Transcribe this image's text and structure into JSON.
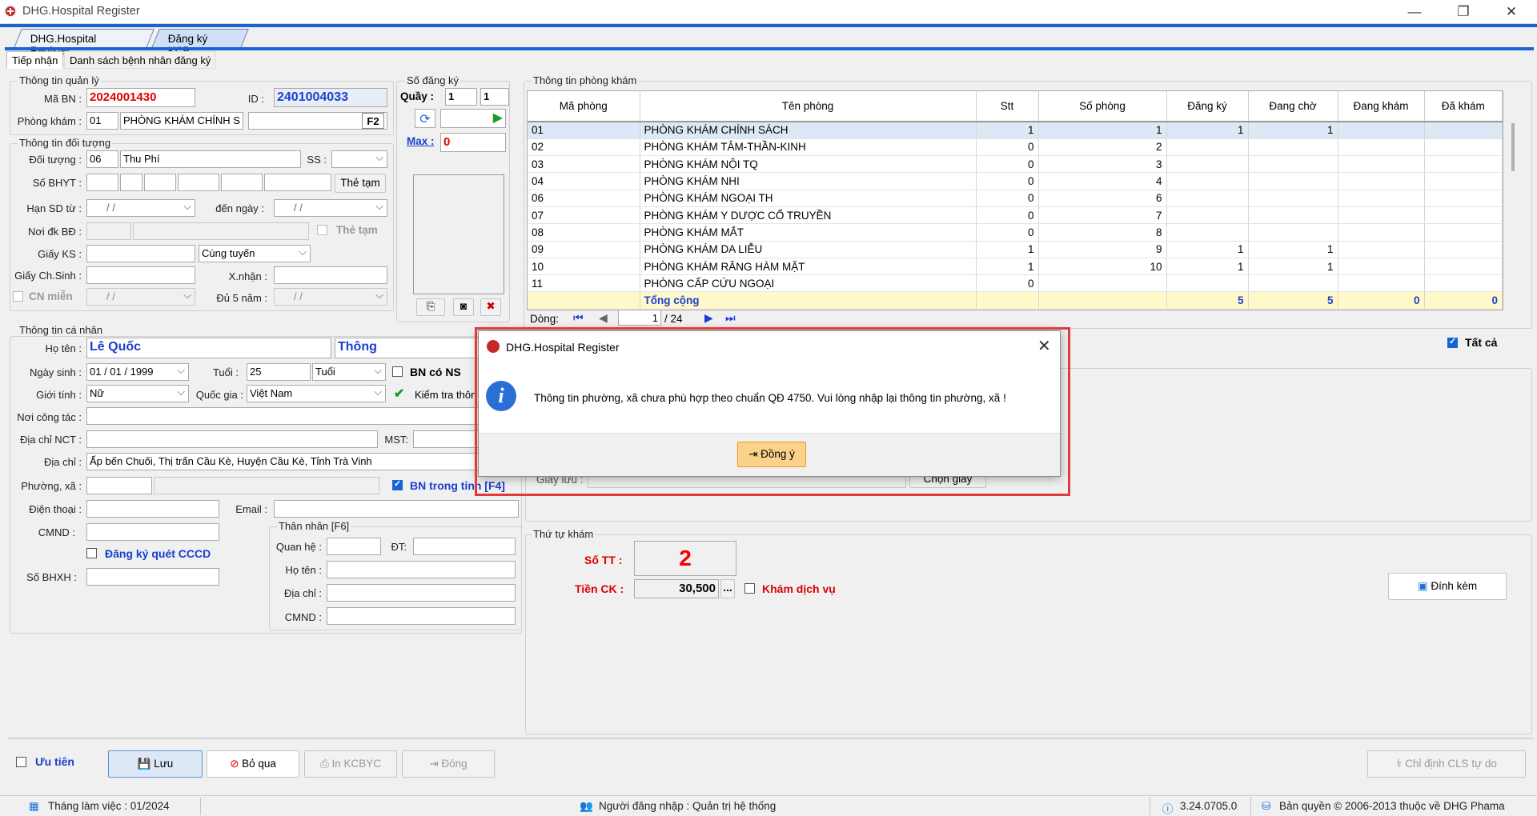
{
  "window": {
    "title": "DHG.Hospital Register",
    "minimize": "—",
    "maximize": "❐",
    "close": "✕"
  },
  "tabs": [
    "DHG.Hospital Register",
    "Đăng ký KCB"
  ],
  "subtabs": [
    "Tiếp nhận",
    "Danh sách bệnh nhân đăng ký"
  ],
  "quanly": {
    "group": "Thông tin quản lý",
    "ma_bn_label": "Mã BN :",
    "ma_bn": "2024001430",
    "id_label": "ID :",
    "id": "2401004033",
    "phong_kham_label": "Phòng khám :",
    "phong_code": "01",
    "phong_name": "PHÒNG KHÁM CHÍNH S",
    "f2": "F2"
  },
  "sodangky": {
    "group": "Số đăng ký",
    "quay_label": "Quầy :",
    "quay1": "1",
    "quay2": "1",
    "max_label": "Max :",
    "max": "0"
  },
  "doituong": {
    "group": "Thông tin đối tượng",
    "doituong_label": "Đối tượng :",
    "code": "06",
    "name": "Thu Phí",
    "ss_label": "SS :",
    "sobhyt_label": "Số BHYT :",
    "the_tam": "Thẻ tạm",
    "hansd_label": "Hạn SD từ :",
    "date_blank": "/ /",
    "den_ngay_label": "đến ngày :",
    "noidk_label": "Nơi đk BĐ :",
    "the_tam2": "Thẻ tạm",
    "giayks_label": "Giấy KS :",
    "cung_tuyen": "Cùng tuyến",
    "giaychsinh_label": "Giấy Ch.Sinh :",
    "xnhan_label": "X.nhận :",
    "cn_mien": "CN miễn",
    "du5nam_label": "Đủ 5 năm :"
  },
  "canhan": {
    "group": "Thông tin cá nhân",
    "hoten_label": "Họ tên :",
    "ho": "Lê Quốc",
    "ten": "Thông",
    "ngaysinh_label": "Ngày sinh :",
    "ngaysinh": "01 / 01 / 1999",
    "tuoi_label": "Tuổi :",
    "tuoi": "25",
    "tuoi_unit": "Tuổi",
    "bn_co_ns": "BN có NS",
    "gioitinh_label": "Giới tính :",
    "gioitinh": "Nữ",
    "quocgia_label": "Quốc gia :",
    "quocgia": "Việt Nam",
    "kiem_tra": "Kiểm tra thôn",
    "noicongtac_label": "Nơi công tác :",
    "diachinct_label": "Địa chỉ NCT :",
    "mst_label": "MST:",
    "diachi_label": "Địa chỉ :",
    "diachi": "Ấp bến Chuối, Thị trấn Cầu Kè, Huyện Cầu Kè, Tỉnh Trà Vinh",
    "phuongxa_label": "Phường, xã :",
    "bn_trong_tinh": "BN trong tỉnh [F4]",
    "dienthoai_label": "Điện thoại :",
    "email_label": "Email :",
    "cmnd_label": "CMND :",
    "dk_quet_cccd": "Đăng ký quét CCCD",
    "sobhxh_label": "Số BHXH :"
  },
  "thannhan": {
    "group": "Thân nhân [F6]",
    "quanhe_label": "Quan hệ :",
    "dt_label": "ĐT:",
    "hoten_label": "Họ tên :",
    "diachi_label": "Địa chỉ :",
    "cmnd_label": "CMND :"
  },
  "phongkham": {
    "group": "Thông tin phòng khám",
    "columns": [
      "Mã phòng",
      "Tên phòng",
      "Stt",
      "Số phòng",
      "Đăng ký",
      "Đang chờ",
      "Đang khám",
      "Đã khám"
    ],
    "rows": [
      [
        "01",
        "PHÒNG KHÁM CHÍNH SÁCH",
        "1",
        "1",
        "1",
        "1",
        "",
        ""
      ],
      [
        "02",
        "PHÒNG KHÁM TÂM-THẦN-KINH",
        "0",
        "2",
        "",
        "",
        "",
        ""
      ],
      [
        "03",
        "PHÒNG KHÁM NỘI TQ",
        "0",
        "3",
        "",
        "",
        "",
        ""
      ],
      [
        "04",
        "PHÒNG KHÁM NHI",
        "0",
        "4",
        "",
        "",
        "",
        ""
      ],
      [
        "06",
        "PHÒNG KHÁM NGOẠI TH",
        "0",
        "6",
        "",
        "",
        "",
        ""
      ],
      [
        "07",
        "PHÒNG KHÁM Y DƯỢC CỔ TRUYỀN",
        "0",
        "7",
        "",
        "",
        "",
        ""
      ],
      [
        "08",
        "PHÒNG KHÁM MẮT",
        "0",
        "8",
        "",
        "",
        "",
        ""
      ],
      [
        "09",
        "PHÒNG KHÁM DA LIỄU",
        "1",
        "9",
        "1",
        "1",
        "",
        ""
      ],
      [
        "10",
        "PHÒNG KHÁM RĂNG HÀM MẶT",
        "1",
        "10",
        "1",
        "1",
        "",
        ""
      ],
      [
        "11",
        "PHÒNG CẤP CỨU NGOẠI",
        "0",
        "",
        "",
        "",
        "",
        ""
      ]
    ],
    "total": [
      "",
      "Tổng cộng",
      "",
      "",
      "5",
      "5",
      "0",
      "0"
    ],
    "dong_label": "Dòng:",
    "page": "1",
    "pages": "/ 24",
    "tat_ca": "Tất cả"
  },
  "giayluu": {
    "label": "Giấy lưu :",
    "chon_giay": "Chọn giấy"
  },
  "thutu": {
    "group": "Thứ tự khám",
    "so_tt_label": "Số TT :",
    "so_tt": "2",
    "tien_ck_label": "Tiền CK :",
    "tien_ck": "30,500",
    "dots": "...",
    "kham_dich_vu": "Khám dịch vụ",
    "dinh_kem": "Đính kèm"
  },
  "buttons": {
    "uu_tien": "Ưu tiên",
    "luu": "Lưu",
    "bo_qua": "Bỏ qua",
    "in_kcbyc": "In KCBYC",
    "dong": "Đóng",
    "chi_dinh": "Chỉ định CLS tự do"
  },
  "dialog": {
    "title": "DHG.Hospital Register",
    "message": "Thông tin phường, xã chưa phù hợp theo chuẩn QĐ 4750. Vui lòng nhập lại thông tin phường, xã !",
    "ok": "Đồng ý"
  },
  "status": {
    "thang": "Tháng làm việc : 01/2024",
    "nguoi": "Người đăng nhập : Quản trị hệ thống",
    "version": "3.24.0705.0",
    "banquyen": "Bản quyền © 2006-2013 thuộc về DHG Phama"
  }
}
